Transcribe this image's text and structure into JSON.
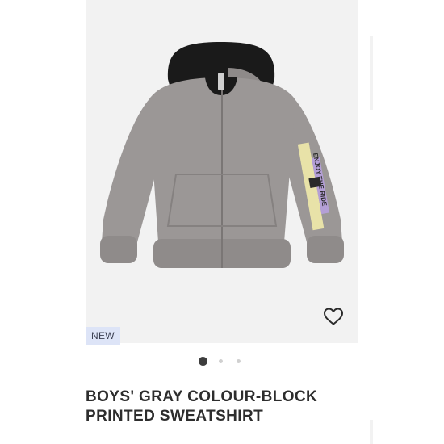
{
  "product": {
    "badge": "NEW",
    "title": "BOYS' GRAY COLOUR-BLOCK PRINTED SWEATSHIRT",
    "sleeve_print": "ENJOY THE RIDE",
    "image_count": 3,
    "active_image": 1
  },
  "icons": {
    "favorite": "heart-outline-icon"
  },
  "colors": {
    "background": "#ffffff",
    "image_background": "#f2f2f2",
    "hoodie_body": "#9b9796",
    "hood_lining": "#1a1a1a",
    "badge_background": "#dde4f7",
    "active_dot": "#3d3d3d",
    "inactive_dot": "#d0d0d0",
    "title_text": "#2d2d2d"
  }
}
